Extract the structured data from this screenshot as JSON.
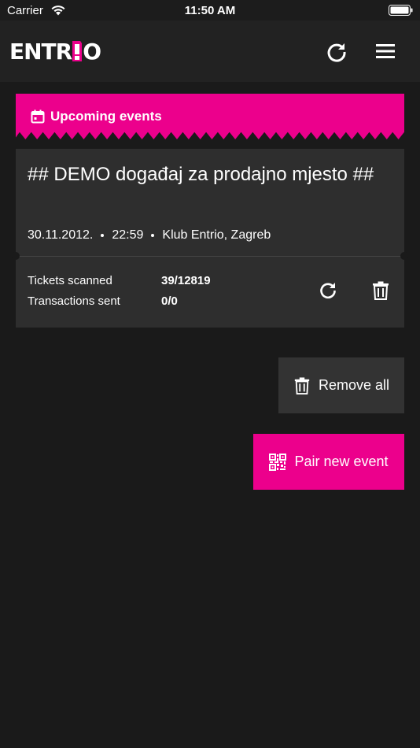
{
  "status_bar": {
    "carrier": "Carrier",
    "time": "11:50 AM",
    "wifi_icon": "wifi-icon",
    "battery_icon": "battery-icon"
  },
  "nav": {
    "logo_text_left": "ENTR",
    "logo_text_right": "O",
    "logo_accent_color": "#ec008c",
    "refresh_icon": "refresh-icon",
    "menu_icon": "hamburger-menu-icon"
  },
  "section": {
    "title": "Upcoming events",
    "icon": "calendar-icon",
    "color": "#ec008c"
  },
  "event": {
    "title": "## DEMO događaj za prodajno mjesto ##",
    "date": "30.11.2012.",
    "time": "22:59",
    "venue": "Klub Entrio, Zagreb",
    "tickets_scanned_label": "Tickets scanned",
    "tickets_scanned_value": "39/12819",
    "transactions_sent_label": "Transactions sent",
    "transactions_sent_value": "0/0"
  },
  "actions": {
    "remove_all_label": "Remove all",
    "pair_new_event_label": "Pair new event"
  }
}
